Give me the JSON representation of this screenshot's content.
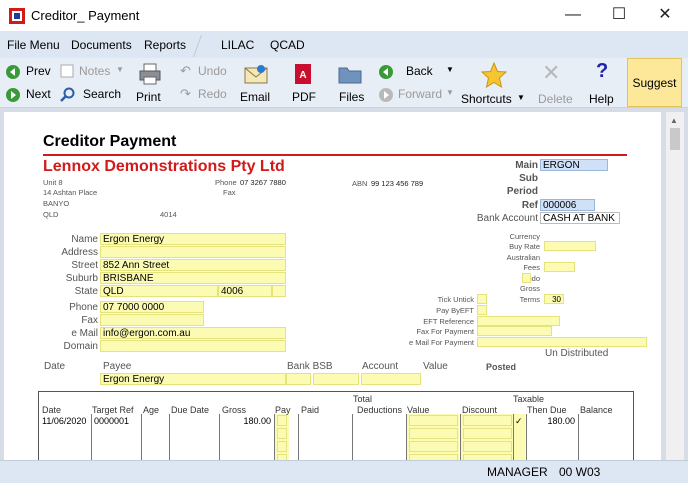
{
  "window": {
    "title": "Creditor_ Payment"
  },
  "menu": [
    "File Menu",
    "Documents",
    "Reports",
    "LILAC",
    "QCAD"
  ],
  "toolbar": {
    "prev": "Prev",
    "next": "Next",
    "notes": "Notes",
    "search": "Search",
    "print": "Print",
    "undo": "Undo",
    "redo": "Redo",
    "email": "Email",
    "pdf": "PDF",
    "files": "Files",
    "back": "Back",
    "forward": "Forward",
    "shortcuts": "Shortcuts",
    "delete": "Delete",
    "help": "Help",
    "suggest": "Suggest"
  },
  "doc": {
    "title": "Creditor Payment",
    "company": "Lennox Demonstrations Pty Ltd",
    "address": [
      "Unit 8",
      "14 Ashtan Place",
      "BANYO",
      "QLD"
    ],
    "postcode": "4014",
    "phone_label": "Phone",
    "phone": "07 3267 7880",
    "fax_label": "Fax",
    "abn_label": "ABN",
    "abn": "99 123 456 789",
    "main_label": "Main",
    "main": "ERGON",
    "sub_label": "Sub",
    "period_label": "Period",
    "ref_label": "Ref",
    "ref": "000006",
    "bank_label": "Bank Account",
    "bank": "CASH AT BANK",
    "labels": {
      "name": "Name",
      "address": "Address",
      "street": "Street",
      "suburb": "Suburb",
      "state": "State",
      "phone": "Phone",
      "fax": "Fax",
      "email": "e Mail",
      "domain": "Domain"
    },
    "supplier": {
      "name": "Ergon Energy",
      "street": "852 Ann Street",
      "suburb": "BRISBANE",
      "state": "QLD",
      "postcode": "4006",
      "phone": "07 7000 0000",
      "email": "info@ergon.com.au"
    },
    "right_labels": {
      "currency": "Currency",
      "buy_rate": "Buy Rate",
      "australian": "Australian",
      "fees": "Fees",
      "undo": "Undo",
      "gross": "Gross",
      "terms": "Terms",
      "tick_untick": "Tick Untick",
      "pay_by_eft": "Pay ByEFT",
      "eft_reference": "EFT Reference",
      "fax_for_payment": "Fax For Payment",
      "email_for_payment": "e Mail For Payment",
      "un_distributed": "Un Distributed"
    },
    "terms": "30",
    "payee_headers": {
      "date": "Date",
      "payee": "Payee",
      "bank_bsb": "Bank BSB",
      "account": "Account",
      "value": "Value",
      "posted": "Posted"
    },
    "payee": "Ergon Energy",
    "grid_headers": {
      "date": "Date",
      "target_ref": "Target Ref",
      "age": "Age",
      "due_date": "Due Date",
      "gross": "Gross",
      "pay": "Pay",
      "paid": "Paid",
      "total": "Total",
      "deductions": "Deductions",
      "value": "Value",
      "discount": "Discount",
      "taxable": "Taxable",
      "then_due": "Then Due",
      "balance": "Balance"
    },
    "rows": [
      {
        "date": "11/06/2020",
        "target_ref": "0000001",
        "gross": "180.00",
        "taxable": "✓",
        "then_due": "180.00"
      }
    ]
  },
  "status": {
    "user": "MANAGER",
    "code": "00 W03"
  }
}
